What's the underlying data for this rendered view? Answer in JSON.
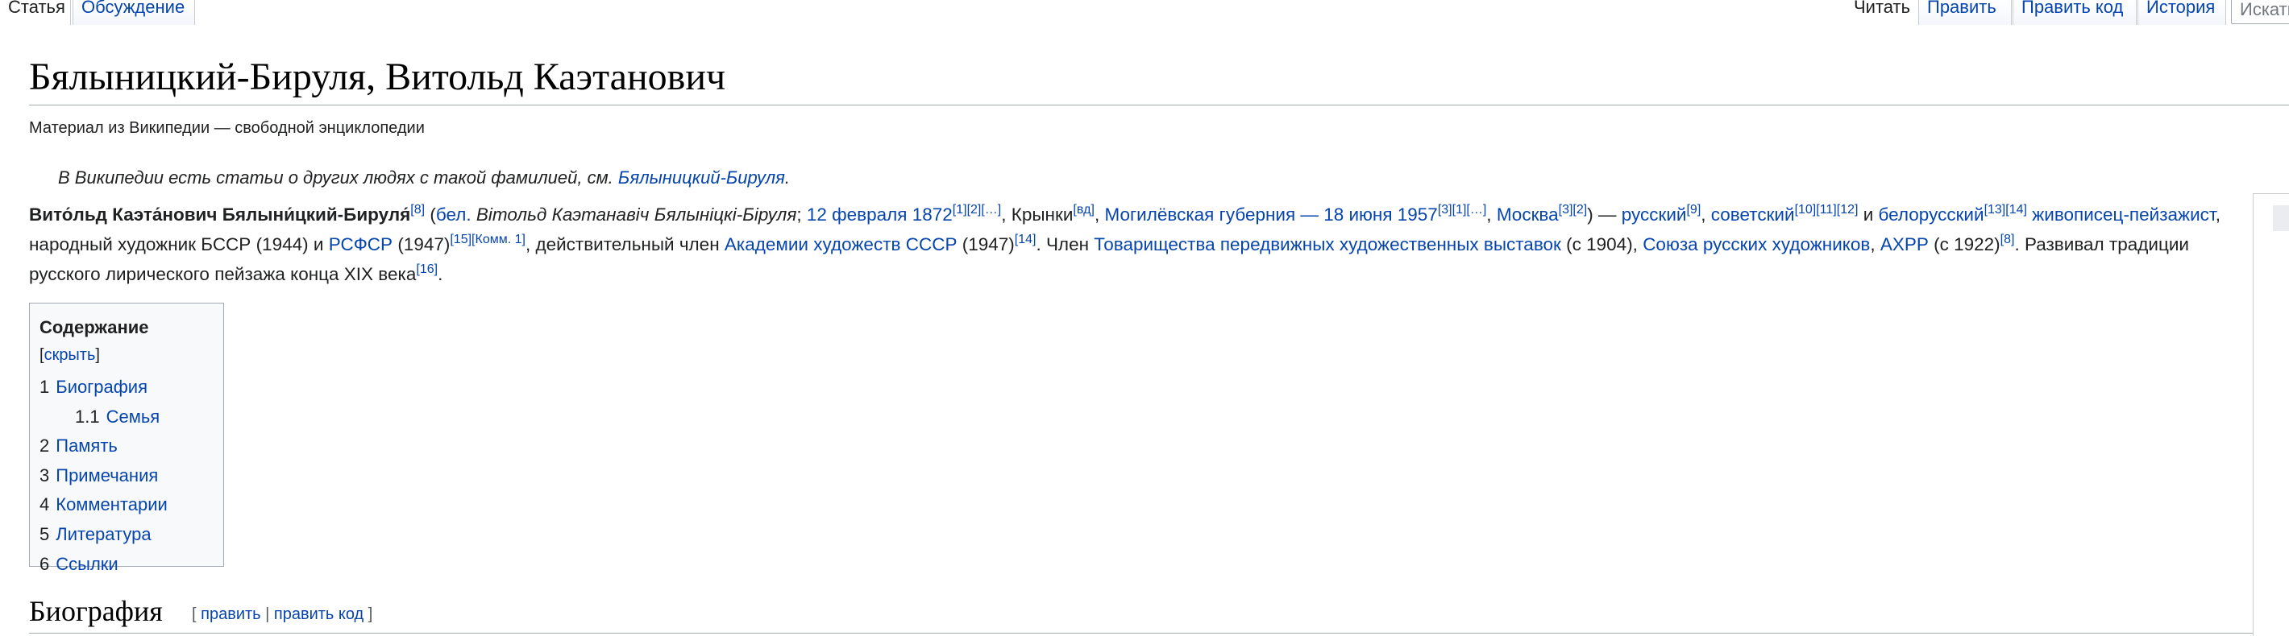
{
  "tabs": {
    "article": "Статья",
    "talk": "Обсуждение",
    "read": "Читать",
    "edit": "Править",
    "edit_source": "Править код",
    "history": "История",
    "search_placeholder": "Искать"
  },
  "page": {
    "title": "Бялыницкий-Бируля, Витольд Каэтанович",
    "tagline": "Материал из Википедии — свободной энциклопедии"
  },
  "hatnote": {
    "prefix": "В Википедии есть статьи о других людях с такой фамилией, см. ",
    "link": "Бялыницкий-Бируля",
    "suffix": "."
  },
  "lead": {
    "name_bold": "Вито́льд Каэта́нович Бялыни́цкий-Бируля́",
    "ref8": "[8]",
    "paren_open": " (",
    "bel_link": "бел.",
    "bel_name": " Вітольд Каэтанавіч Бялыніцкі-Біруля",
    "semicolon": "; ",
    "birth_date": "12 февраля 1872",
    "refs_birth": "[1][2][…]",
    "comma1": ", Крынки",
    "vd": "[вд]",
    "comma2": ", ",
    "gubernia": "Могилёвская губерния",
    "dash1": " — ",
    "death_date": "18 июня 1957",
    "refs_death": "[3][1][…]",
    "comma3": ", ",
    "moscow": "Москва",
    "refs_moscow": "[3][2]",
    "paren_close": ") — ",
    "russian": "русский",
    "ref9": "[9]",
    "comma4": ", ",
    "soviet": "советский",
    "refs_soviet": "[10][11][12]",
    "and1": " и ",
    "belarusian": "белорусский",
    "refs_bel": "[13][14]",
    "space1": " ",
    "painter": "живописец-пейзажист",
    "artist_text": ", народный художник БССР (1944) и ",
    "rsfsr": "РСФСР",
    "year1947": " (1947)",
    "refs_rsfsr": "[15][Комм. 1]",
    "member_text": ", действительный член ",
    "academy": "Академии художеств СССР",
    "year1947b": " (1947)",
    "ref14": "[14]",
    "member2": ". Член ",
    "peredvizh": "Товарищества передвижных художественных выставок",
    "since1904": " (с 1904), ",
    "union": "Союза русских художников",
    "comma5": ", ",
    "akhrr": "АХРР",
    "since1922": " (с 1922)",
    "ref8b": "[8]",
    "period1": ". Развивал традиции русского лирического пейзажа конца XIX века",
    "ref16": "[16]",
    "period2": "."
  },
  "toc": {
    "title": "Содержание",
    "bracket_open": " [",
    "toggle": "скрыть",
    "bracket_close": "]",
    "items": [
      {
        "num": "1",
        "label": "Биография"
      },
      {
        "num": "1.1",
        "label": "Семья"
      },
      {
        "num": "2",
        "label": "Память"
      },
      {
        "num": "3",
        "label": "Примечания"
      },
      {
        "num": "4",
        "label": "Комментарии"
      },
      {
        "num": "5",
        "label": "Литература"
      },
      {
        "num": "6",
        "label": "Ссылки"
      }
    ]
  },
  "section": {
    "heading": "Биография",
    "open": "[ ",
    "edit": "править",
    "sep": " | ",
    "edit_source": "править код",
    "close": " ]"
  }
}
